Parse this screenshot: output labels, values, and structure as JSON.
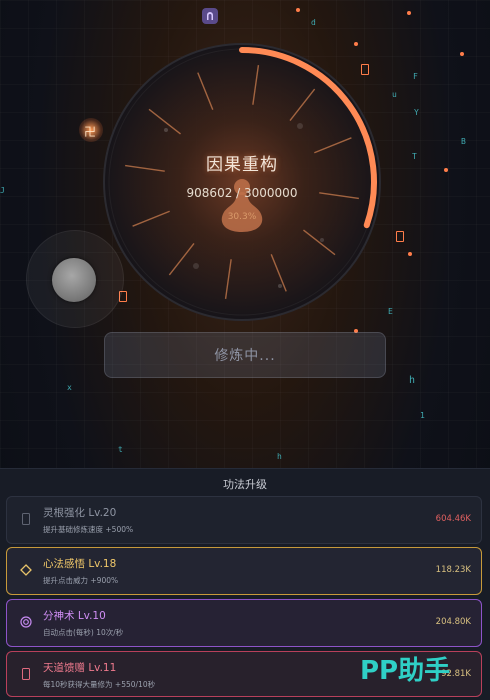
{
  "colors": {
    "accent_orange": "#ff8a55",
    "dim_card_border": "#2d3240",
    "yellow_card": "#c79a3a",
    "purple_card": "#8d54c9",
    "pink_card": "#b8405b",
    "cost_red": "#e06060",
    "cost_gold": "#d8c080"
  },
  "top_badge": {
    "icon": "arch-icon"
  },
  "realm": {
    "title": "因果重构",
    "progress_text": "908602 / 3000000",
    "percent_text": "30.3%",
    "progress_fraction": 0.303
  },
  "joystick": {
    "knob": "joystick-knob"
  },
  "cultivate_button": {
    "label": "修炼中..."
  },
  "floating_glyphs": {
    "swastika": "卍",
    "letters": [
      "d",
      "F",
      "u",
      "Y",
      "B",
      "T",
      "E",
      "x",
      "h",
      "1",
      "t",
      "h",
      "J"
    ]
  },
  "upgrades": {
    "title": "功法升级",
    "items": [
      {
        "name": "灵根强化 Lv.20",
        "desc": "提升基础修炼速度 +500%",
        "cost": "604.46K",
        "icon": "rectangle-icon",
        "state": "locked"
      },
      {
        "name": "心法感悟 Lv.18",
        "desc": "提升点击威力 +900%",
        "cost": "118.23K",
        "icon": "diamond-icon",
        "state": "available"
      },
      {
        "name": "分神术 Lv.10",
        "desc": "自动点击(每秒) 10次/秒",
        "cost": "204.80K",
        "icon": "concentric-circle-icon",
        "state": "available"
      },
      {
        "name": "天道馈赠 Lv.11",
        "desc": "每10秒获得大量修为 +550/10秒",
        "cost": "92.81K",
        "icon": "rectangle-icon",
        "state": "available"
      }
    ]
  },
  "watermark": {
    "text": "PP助手"
  }
}
